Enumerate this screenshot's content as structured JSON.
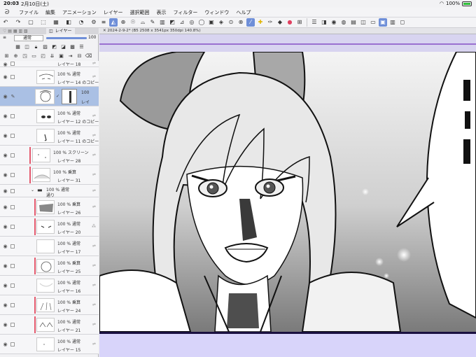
{
  "status": {
    "time": "20:03",
    "date": "2月10日(土)",
    "battery": "100%"
  },
  "menu": {
    "items": [
      "ファイル",
      "編集",
      "アニメーション",
      "レイヤー",
      "選択範囲",
      "表示",
      "フィルター",
      "ウィンドウ",
      "ヘルプ"
    ]
  },
  "panel": {
    "tab_label": "レイヤー",
    "blend_mode": "通常",
    "opacity": "100",
    "layers": [
      {
        "pct": "",
        "name": "レイヤー 18"
      },
      {
        "pct": "100 % 通常",
        "name": "レイヤー 14 のコピー"
      },
      {
        "pct": "100",
        "name": "レイ"
      },
      {
        "pct": "100 % 通常",
        "name": "レイヤー 12 のコピー"
      },
      {
        "pct": "100 % 通常",
        "name": "レイヤー 11 のコピー"
      },
      {
        "pct": "100 % スクリーン",
        "name": "レイヤー 28"
      },
      {
        "pct": "100 % 乗算",
        "name": "レイヤー 31"
      },
      {
        "pct": "100 % 通常",
        "name": "通り"
      },
      {
        "pct": "100 % 乗算",
        "name": "レイヤー 26"
      },
      {
        "pct": "100 % 通常",
        "name": "レイヤー 20"
      },
      {
        "pct": "100 % 通常",
        "name": "レイヤー 17"
      },
      {
        "pct": "100 % 乗算",
        "name": "レイヤー 25"
      },
      {
        "pct": "100 % 通常",
        "name": "レイヤー 16"
      },
      {
        "pct": "100 % 乗算",
        "name": "レイヤー 24"
      },
      {
        "pct": "100 % 通常",
        "name": "レイヤー 21"
      },
      {
        "pct": "100 % 通常",
        "name": "レイヤー 15"
      }
    ]
  },
  "canvas": {
    "doc_tab": "2024-2-9-2* (B5 2508 x 3541px 350dpi 140.8%)"
  },
  "colors": {
    "accent": "#6f8fd8",
    "purple_line": "#9a70d0",
    "mask": "#e45a6e"
  }
}
